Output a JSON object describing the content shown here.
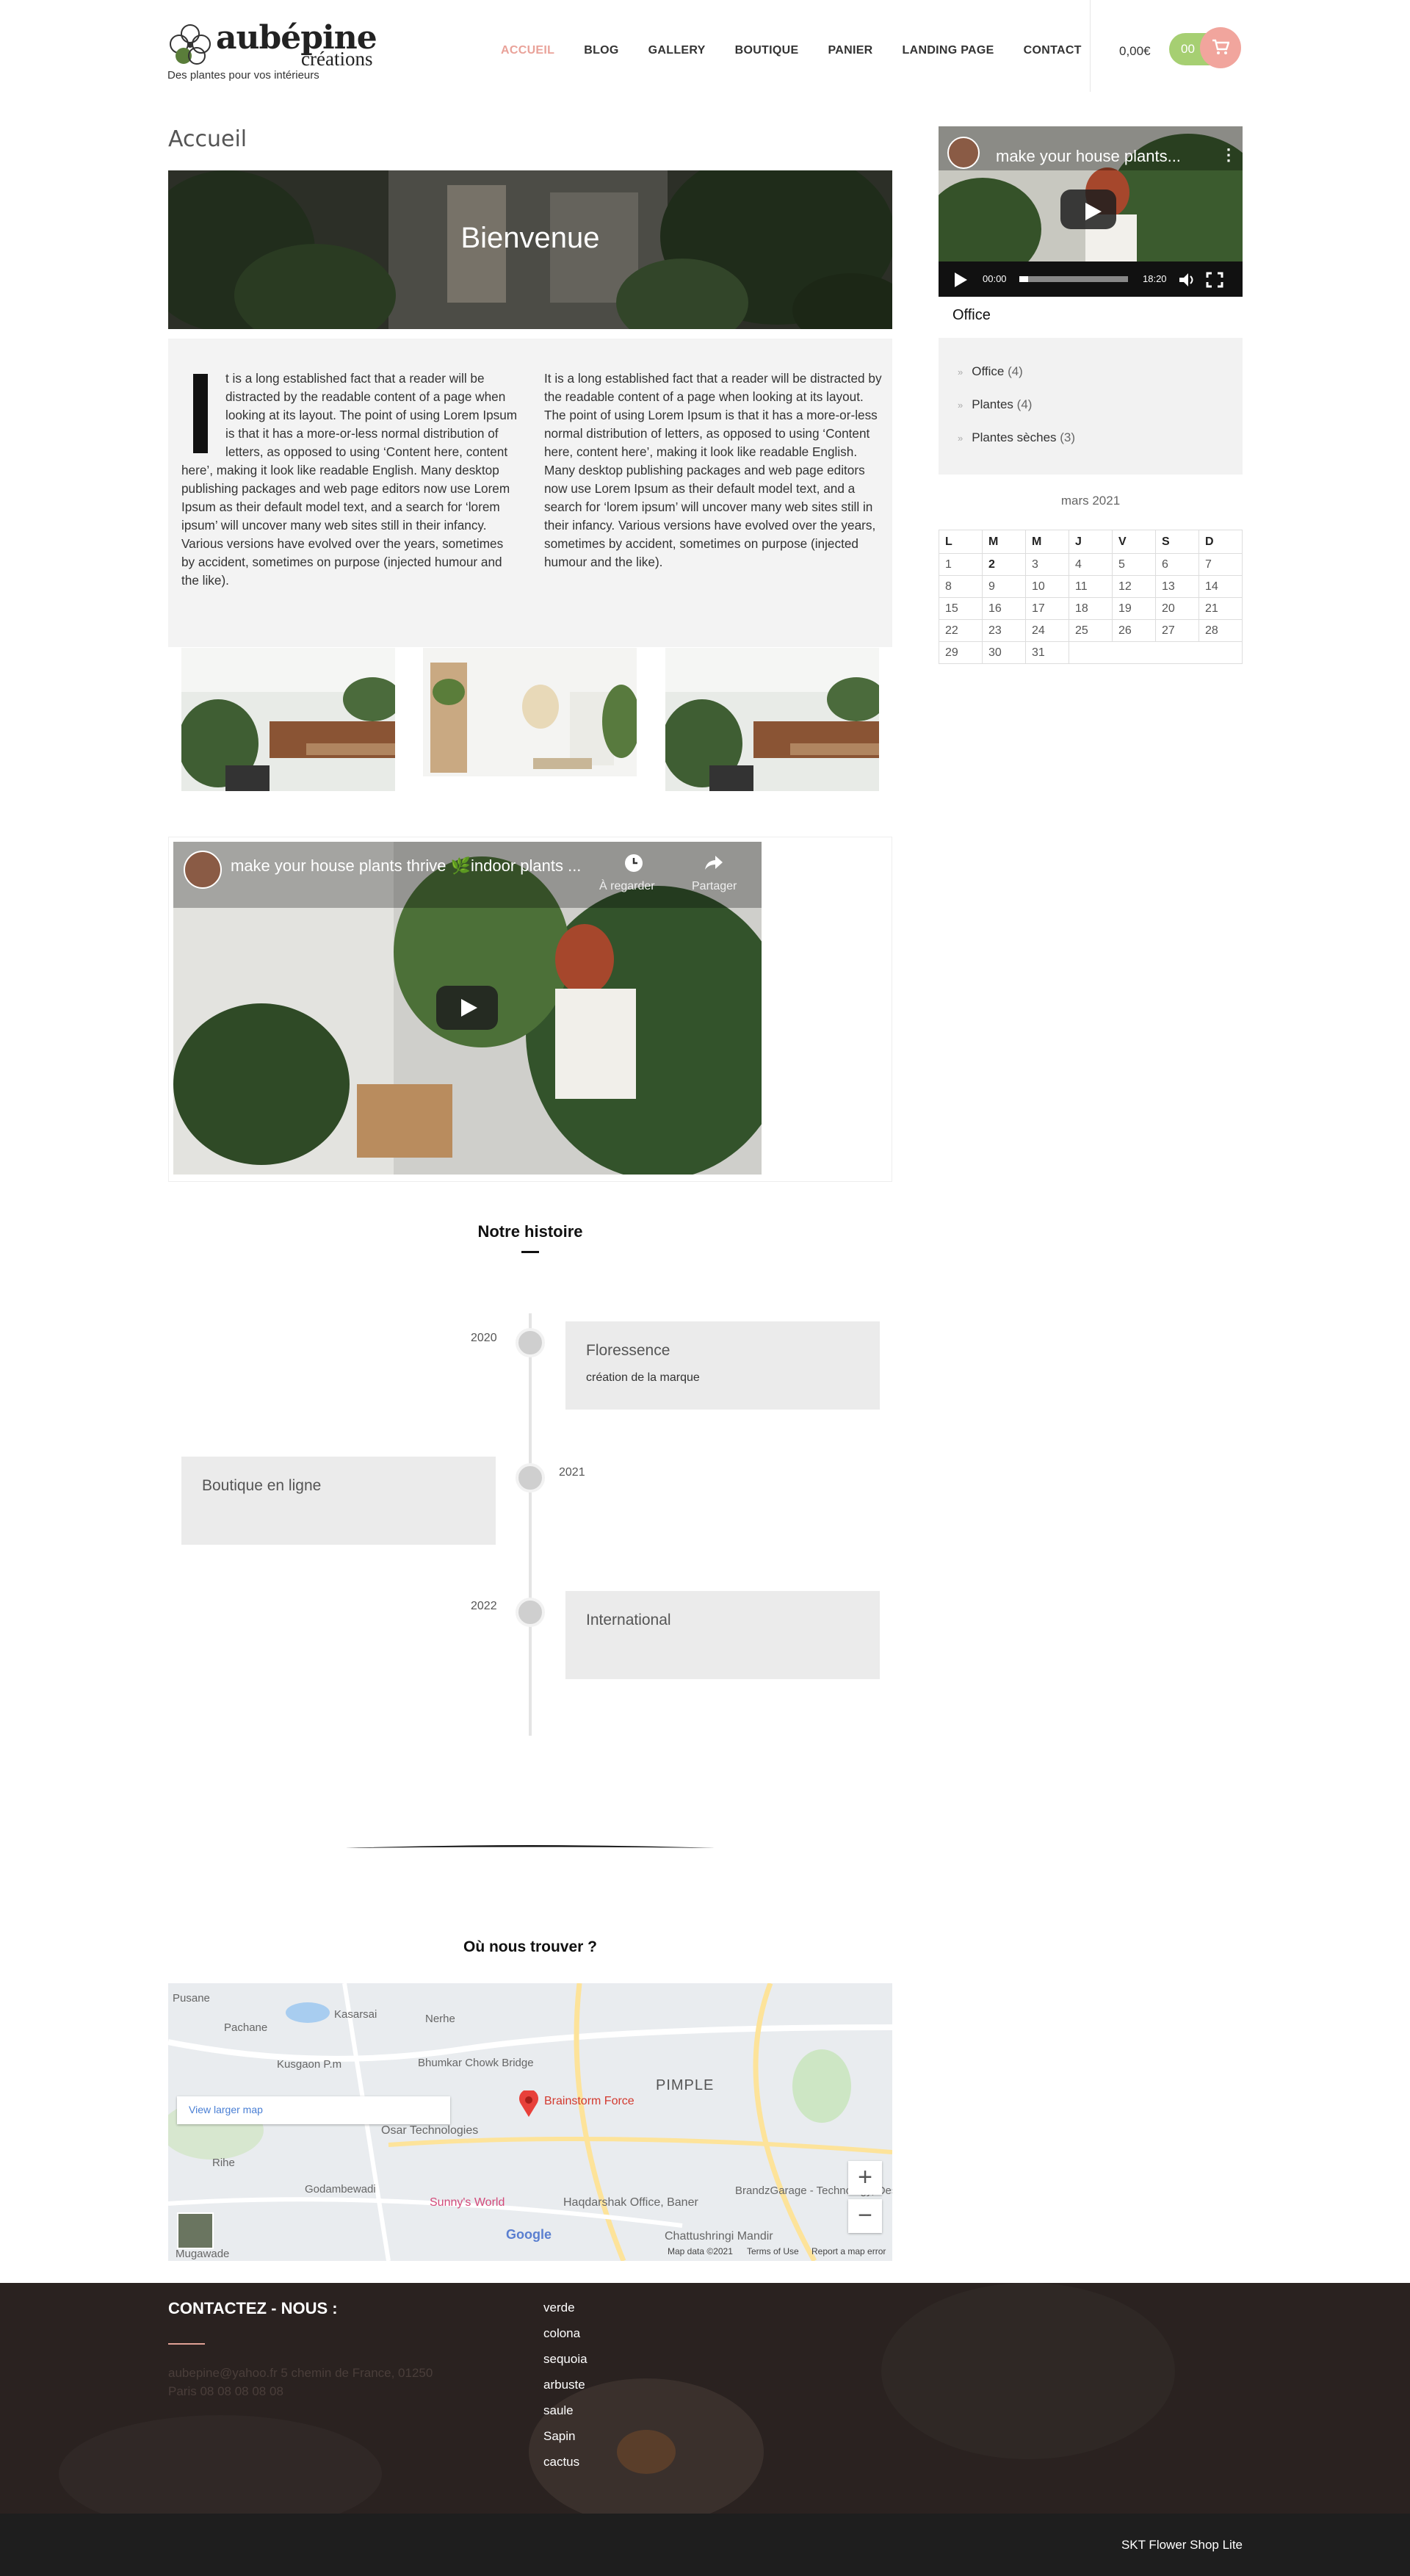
{
  "header": {
    "logo_text": "aubépine",
    "logo_sub": "créations",
    "tagline": "Des plantes pour vos intérieurs",
    "nav": [
      "ACCUEIL",
      "BLOG",
      "GALLERY",
      "BOUTIQUE",
      "PANIER",
      "LANDING PAGE",
      "CONTACT"
    ],
    "active_nav": "ACCUEIL",
    "cart_total": "0,00€",
    "cart_count": "00"
  },
  "main": {
    "page_title": "Accueil",
    "banner_title": "Bienvenue",
    "col1_text": "t is a long established fact that a reader will be distracted by the readable content of a page when looking at its layout. The point of using Lorem Ipsum is that it has a more-or-less normal distribution of letters, as opposed to using ‘Content here, content here’, making it look like readable English. Many desktop publishing packages and web page editors now use Lorem Ipsum as their default model text, and a search for ‘lorem ipsum’ will uncover many web sites still in their infancy. Various versions have evolved over the years, sometimes by accident, sometimes on purpose (injected humour and the like).",
    "col2_text": "It is a long established fact that a reader will be distracted by the readable content of a page when looking at its layout. The point of using Lorem Ipsum is that it has a more-or-less normal distribution of letters, as opposed to using ‘Content here, content here’, making it look like readable English. Many desktop publishing packages and web page editors now use Lorem Ipsum as their default model text, and a search for ‘lorem ipsum’ will uncover many web sites still in their infancy. Various versions have evolved over the years, sometimes by accident, sometimes on purpose (injected humour and the like).",
    "video_title": "make your house plants thrive 🌿indoor plants ...",
    "video_watch_later": "À regarder",
    "video_share": "Partager",
    "history_title": "Notre histoire",
    "timeline": [
      {
        "year": "2020",
        "title": "Floressence",
        "desc": "création de la marque"
      },
      {
        "year": "2021",
        "title": "Boutique en ligne",
        "desc": ""
      },
      {
        "year": "2022",
        "title": "International",
        "desc": ""
      }
    ],
    "map_title": "Où nous trouver ?",
    "map": {
      "view_larger": "View larger map",
      "labels": [
        "Pusane",
        "Pachane",
        "Kasarsai",
        "Nerhe",
        "Kusgaon P.m",
        "Bhumkar Chowk Bridge",
        "Brainstorm Force",
        "PIMPLE",
        "Osar Technologies",
        "Rihe",
        "Godambewadi",
        "Sunny's World",
        "Haqdarshak Office, Baner",
        "BrandzGarage - Technology, Design",
        "Chattushringi Mandir",
        "Mugawade",
        "Google"
      ],
      "footer": [
        "Map data ©2021",
        "Terms of Use",
        "Report a map error"
      ]
    }
  },
  "sidebar": {
    "video_title": "make your house plants...",
    "video_time_current": "00:00",
    "video_time_total": "18:20",
    "widget_title": "Office",
    "categories": [
      {
        "name": "Office",
        "count": "(4)"
      },
      {
        "name": "Plantes",
        "count": "(4)"
      },
      {
        "name": "Plantes sèches",
        "count": "(3)"
      }
    ],
    "calendar_caption": "mars 2021",
    "calendar_days": [
      "L",
      "M",
      "M",
      "J",
      "V",
      "S",
      "D"
    ],
    "calendar_weeks": [
      [
        "1",
        "2",
        "3",
        "4",
        "5",
        "6",
        "7"
      ],
      [
        "8",
        "9",
        "10",
        "11",
        "12",
        "13",
        "14"
      ],
      [
        "15",
        "16",
        "17",
        "18",
        "19",
        "20",
        "21"
      ],
      [
        "22",
        "23",
        "24",
        "25",
        "26",
        "27",
        "28"
      ],
      [
        "29",
        "30",
        "31",
        "",
        "",
        "",
        ""
      ]
    ]
  },
  "footer": {
    "contact_title": "CONTACTEZ - NOUS :",
    "contact_text": "aubepine@yahoo.fr 5 chemin de France, 01250 Paris 08 08 08 08 08",
    "links": [
      "verde",
      "colona",
      "sequoia",
      "arbuste",
      "saule",
      "Sapin",
      "cactus"
    ],
    "credit": "SKT Flower Shop Lite"
  },
  "colors": {
    "accent": "#e9a299",
    "cart_green": "#a6cf72",
    "cart_pink": "#f1a59d",
    "footer_bg": "#2a2220"
  }
}
